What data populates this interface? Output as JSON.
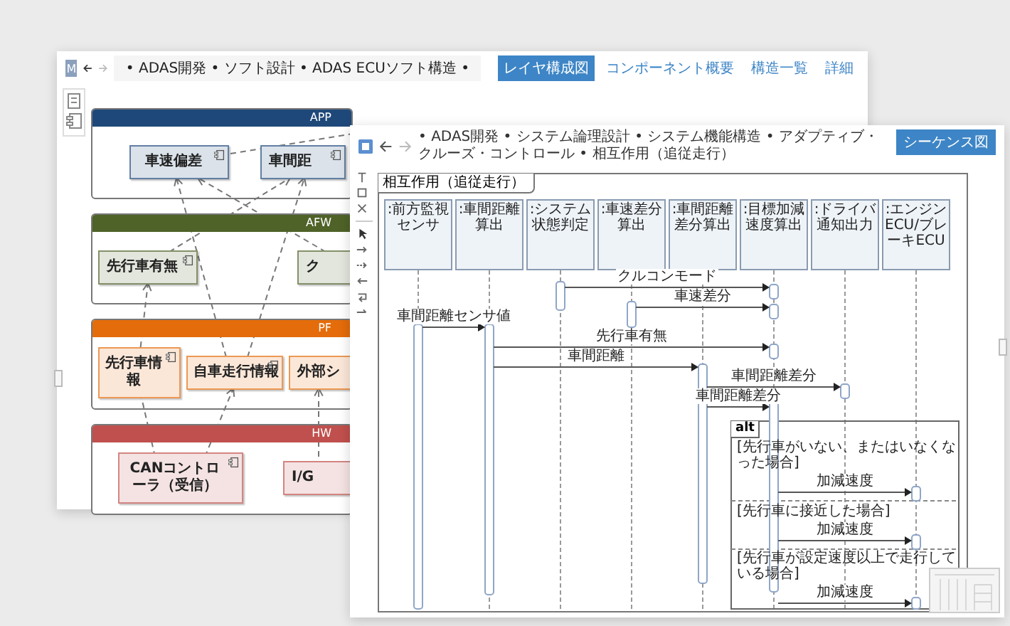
{
  "back_window": {
    "app_icon": "M",
    "breadcrumb": "• ADAS開発 • ソフト設計 • ADAS ECUソフト構造 •",
    "tabs": [
      {
        "label": "レイヤ構成図",
        "selected": true
      },
      {
        "label": "コンポーネント概要",
        "selected": false
      },
      {
        "label": "構造一覧",
        "selected": false
      },
      {
        "label": "詳細",
        "selected": false
      }
    ],
    "layers": [
      {
        "name": "APP",
        "color": "#1f487a",
        "components": [
          "車速偏差",
          "車間距"
        ]
      },
      {
        "name": "AFW",
        "color": "#4f6228",
        "components": [
          "先行車有無",
          "ク"
        ]
      },
      {
        "name": "PF",
        "color": "#e46c0a",
        "components": [
          "先行車情報",
          "自車走行情報",
          "外部シ"
        ]
      },
      {
        "name": "HW",
        "color": "#c0504d",
        "components": [
          "CANコントローラ（受信）",
          "I/G"
        ]
      }
    ]
  },
  "front_window": {
    "breadcrumb": "• ADAS開発 • システム論理設計 • システム機能構造 • アダプティブ・クルーズ・コントロール • 相互作用（追従走行）",
    "button": "シーケンス図",
    "diagram": {
      "title": "相互作用（追従走行）",
      "participants": [
        ":前方監視センサ",
        ":車間距離算出",
        ":システム状態判定",
        ":車速差分算出",
        ":車間距離差分算出",
        ":目標加減速度算出",
        ":ドライバ通知出力",
        ":エンジンECU/ブレーキECU"
      ],
      "messages": [
        "クルコンモード",
        "車速差分",
        "車間距離センサ値",
        "先行車有無",
        "車間距離",
        "車間距離差分",
        "車間距離差分"
      ],
      "fragment": {
        "label": "alt",
        "sections": [
          {
            "guard": "[先行車がいない、またはいなくなった場合]",
            "message": "加減速度"
          },
          {
            "guard": "[先行車に接近した場合]",
            "message": "加減速度"
          },
          {
            "guard": "[先行車が設定速度以上で走行している場合]",
            "message": "加減速度"
          }
        ]
      }
    }
  }
}
